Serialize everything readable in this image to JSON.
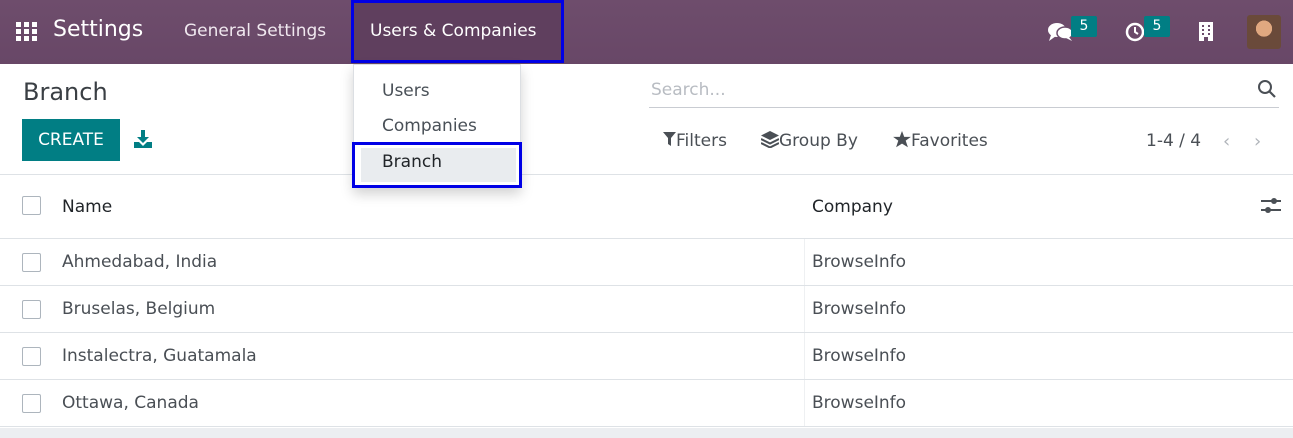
{
  "navbar": {
    "app_title": "Settings",
    "menu": [
      {
        "label": "General Settings"
      },
      {
        "label": "Users & Companies"
      }
    ],
    "messages_badge": "5",
    "activities_badge": "5",
    "icons": [
      "apps-grid-icon",
      "chat-icon",
      "clock-icon",
      "building-icon",
      "user-avatar"
    ]
  },
  "dropdown": {
    "items": [
      {
        "label": "Users"
      },
      {
        "label": "Companies"
      },
      {
        "label": "Branch"
      }
    ]
  },
  "control_panel": {
    "title": "Branch",
    "create_label": "CREATE",
    "search_placeholder": "Search...",
    "filters_label": "Filters",
    "group_by_label": "Group By",
    "favorites_label": "Favorites",
    "pager": "1-4 / 4"
  },
  "table": {
    "columns": {
      "name": "Name",
      "company": "Company"
    },
    "rows": [
      {
        "name": "Ahmedabad, India",
        "company": "BrowseInfo"
      },
      {
        "name": "Bruselas, Belgium",
        "company": "BrowseInfo"
      },
      {
        "name": "Instalectra, Guatamala",
        "company": "BrowseInfo"
      },
      {
        "name": "Ottawa, Canada",
        "company": "BrowseInfo"
      }
    ]
  },
  "colors": {
    "navbar": "#6e4d6c",
    "primary": "#017e84",
    "highlight_border": "#0000e6"
  }
}
